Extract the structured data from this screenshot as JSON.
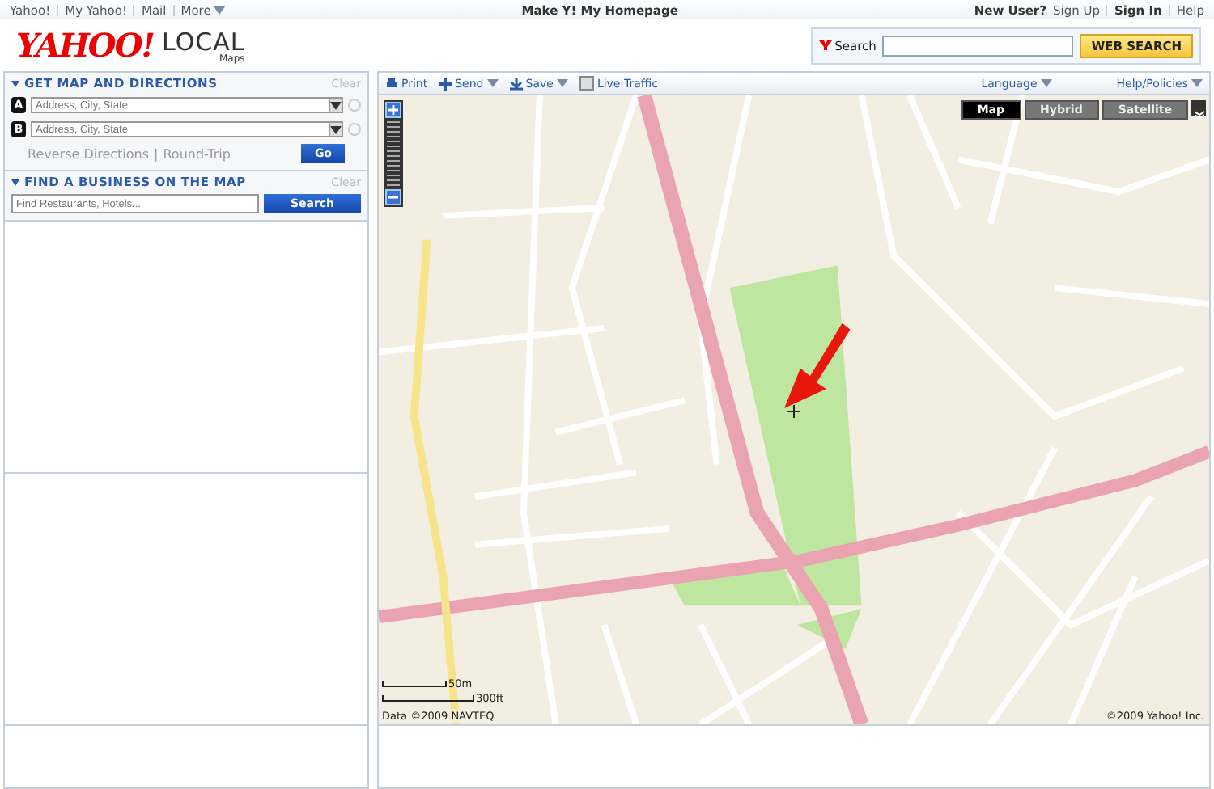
{
  "top_nav": {
    "links": [
      {
        "label": "Yahoo!",
        "kind": "link"
      },
      {
        "label": "My Yahoo!",
        "kind": "link"
      },
      {
        "label": "Mail",
        "kind": "link"
      },
      {
        "label": "More",
        "kind": "menu"
      }
    ],
    "center": "Make Y! My Homepage",
    "new_user": "New User?",
    "sign_up": "Sign Up",
    "sign_in": "Sign In",
    "help": "Help"
  },
  "header": {
    "logo": "YAHOO!",
    "product": "LOCAL",
    "subtitle": "Maps",
    "search_label": "Search",
    "search_button": "WEB SEARCH"
  },
  "directions": {
    "title": "GET MAP AND DIRECTIONS",
    "clear": "Clear",
    "fields": [
      {
        "marker": "A",
        "placeholder": "Address, City, State"
      },
      {
        "marker": "B",
        "placeholder": "Address, City, State"
      }
    ],
    "reverse": "Reverse Directions",
    "separator": "|",
    "round_trip": "Round-Trip",
    "go": "Go"
  },
  "business": {
    "title": "FIND A BUSINESS ON THE MAP",
    "clear": "Clear",
    "placeholder": "Find Restaurants, Hotels...",
    "button": "Search"
  },
  "map_toolbar": {
    "items": [
      {
        "label": "Print",
        "kind": "print"
      },
      {
        "label": "Send",
        "kind": "send"
      },
      {
        "label": "Save",
        "kind": "save"
      }
    ],
    "live_traffic": {
      "label": "Live Traffic",
      "checked": false
    },
    "menus": [
      "Language",
      "Help/Policies"
    ]
  },
  "map": {
    "view_tabs": [
      {
        "label": "Map",
        "selected": true
      },
      {
        "label": "Hybrid",
        "selected": false
      },
      {
        "label": "Satellite",
        "selected": false
      }
    ],
    "scale": [
      "50m",
      "300ft"
    ],
    "data_credit": "Data ©2009 NAVTEQ",
    "copyright": "©2009 Yahoo! Inc."
  }
}
